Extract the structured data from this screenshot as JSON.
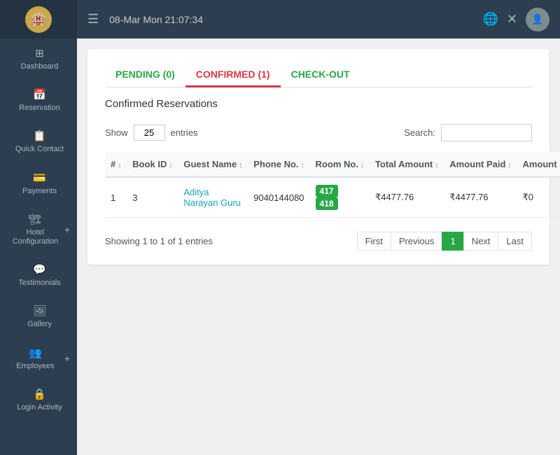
{
  "sidebar": {
    "logo_text": "🏨",
    "items": [
      {
        "id": "dashboard",
        "icon": "⊞",
        "label": "Dashboard",
        "has_plus": false
      },
      {
        "id": "reservation",
        "icon": "📅",
        "label": "Reservation",
        "has_plus": false
      },
      {
        "id": "quick-contact",
        "icon": "📋",
        "label": "Quick Contact",
        "has_plus": false
      },
      {
        "id": "payments",
        "icon": "💳",
        "label": "Payments",
        "has_plus": false
      },
      {
        "id": "hotel-config",
        "icon": "🏗",
        "label": "Hotel Configuration",
        "has_plus": true
      },
      {
        "id": "testimonials",
        "icon": "💬",
        "label": "Testimonials",
        "has_plus": false
      },
      {
        "id": "gallery",
        "icon": "🖼",
        "label": "Gallery",
        "has_plus": false
      },
      {
        "id": "employees",
        "icon": "👥",
        "label": "Employees",
        "has_plus": true
      },
      {
        "id": "login-activity",
        "icon": "🔒",
        "label": "Login Activity",
        "has_plus": false
      }
    ]
  },
  "topbar": {
    "menu_icon": "☰",
    "datetime": "08-Mar Mon 21:07:34",
    "globe_icon": "🌐",
    "close_icon": "✕"
  },
  "tabs": [
    {
      "id": "pending",
      "label": "PENDING (0)",
      "type": "pending"
    },
    {
      "id": "confirmed",
      "label": "CONFIRMED (1)",
      "type": "confirmed"
    },
    {
      "id": "checkout",
      "label": "CHECK-OUT",
      "type": "checkout"
    }
  ],
  "section_title": "Confirmed Reservations",
  "table_controls": {
    "show_label": "Show",
    "entries_label": "entries",
    "entries_value": "25",
    "search_label": "Search:"
  },
  "table": {
    "columns": [
      {
        "id": "num",
        "label": "#"
      },
      {
        "id": "book_id",
        "label": "Book ID"
      },
      {
        "id": "guest_name",
        "label": "Guest Name"
      },
      {
        "id": "phone_no",
        "label": "Phone No."
      },
      {
        "id": "room_no",
        "label": "Room No."
      },
      {
        "id": "total_amount",
        "label": "Total Amount"
      },
      {
        "id": "amount_paid",
        "label": "Amount Paid"
      },
      {
        "id": "amount_due",
        "label": "Amount Due"
      },
      {
        "id": "actions",
        "label": ""
      }
    ],
    "rows": [
      {
        "num": "1",
        "book_id": "3",
        "guest_name": "Aditya Narayan Guru",
        "phone_no": "9040144080",
        "rooms": [
          "417",
          "418"
        ],
        "total_amount": "₹4477.76",
        "amount_paid": "₹4477.76",
        "amount_due": "₹0"
      }
    ]
  },
  "pagination": {
    "showing_text": "Showing 1 to 1 of 1 entries",
    "buttons": [
      "First",
      "Previous",
      "1",
      "Next",
      "Last"
    ]
  }
}
